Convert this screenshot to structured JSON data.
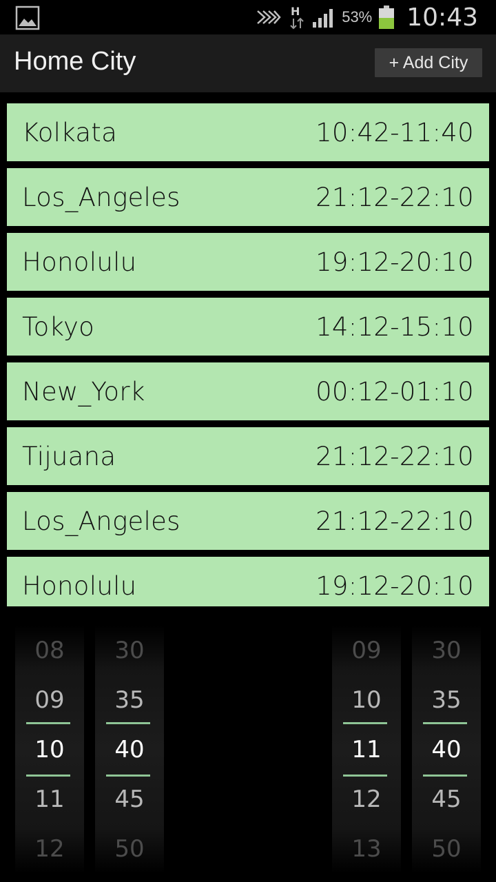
{
  "status_bar": {
    "battery_percent": "53%",
    "time": "10:43",
    "icons": [
      "image-icon",
      "nfc-icon",
      "h-data-icon",
      "signal-icon",
      "battery-icon"
    ]
  },
  "action_bar": {
    "title": "Home City",
    "add_city_label": "+ Add City"
  },
  "cities": [
    {
      "name": "Kolkata",
      "time": "10:42-11:40"
    },
    {
      "name": "Los_Angeles",
      "time": "21:12-22:10"
    },
    {
      "name": "Honolulu",
      "time": "19:12-20:10"
    },
    {
      "name": "Tokyo",
      "time": "14:12-15:10"
    },
    {
      "name": "New_York",
      "time": "00:12-01:10"
    },
    {
      "name": "Tijuana",
      "time": "21:12-22:10"
    },
    {
      "name": "Los_Angeles",
      "time": "21:12-22:10"
    },
    {
      "name": "Honolulu",
      "time": "19:12-20:10"
    }
  ],
  "pickers": {
    "start_hour": [
      "08",
      "09",
      "10",
      "11",
      "12"
    ],
    "start_minute": [
      "30",
      "35",
      "40",
      "45",
      "50"
    ],
    "end_hour": [
      "09",
      "10",
      "11",
      "12",
      "13"
    ],
    "end_minute": [
      "30",
      "35",
      "40",
      "45",
      "50"
    ]
  },
  "colors": {
    "row_background": "#b3e6b0",
    "selection_line": "#8fc596",
    "battery_fill": "#8cc63e"
  }
}
